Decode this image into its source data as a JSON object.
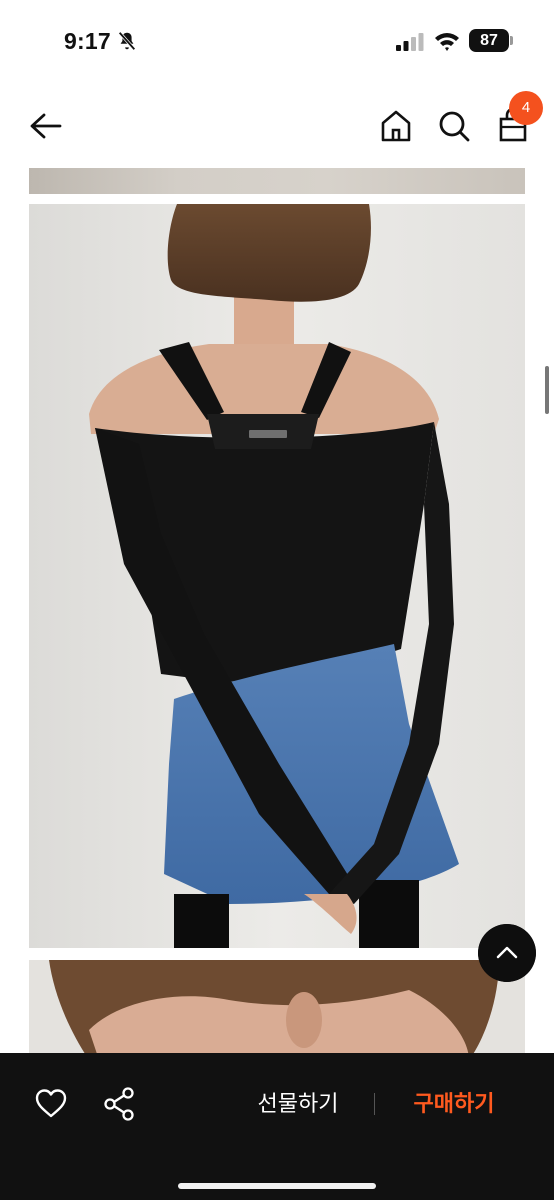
{
  "status_bar": {
    "time": "9:17",
    "battery": "87"
  },
  "nav": {
    "cart_count": "4"
  },
  "actions": {
    "gift_label": "선물하기",
    "buy_label": "구매하기"
  },
  "colors": {
    "accent": "#ff5a1f",
    "badge": "#f4511e",
    "bottom_bar": "#111111"
  },
  "icons": [
    "bell-off-icon",
    "signal-icon",
    "wifi-icon",
    "back-arrow-icon",
    "home-icon",
    "search-icon",
    "shopping-bag-icon",
    "chevron-up-icon",
    "heart-icon",
    "share-icon"
  ]
}
